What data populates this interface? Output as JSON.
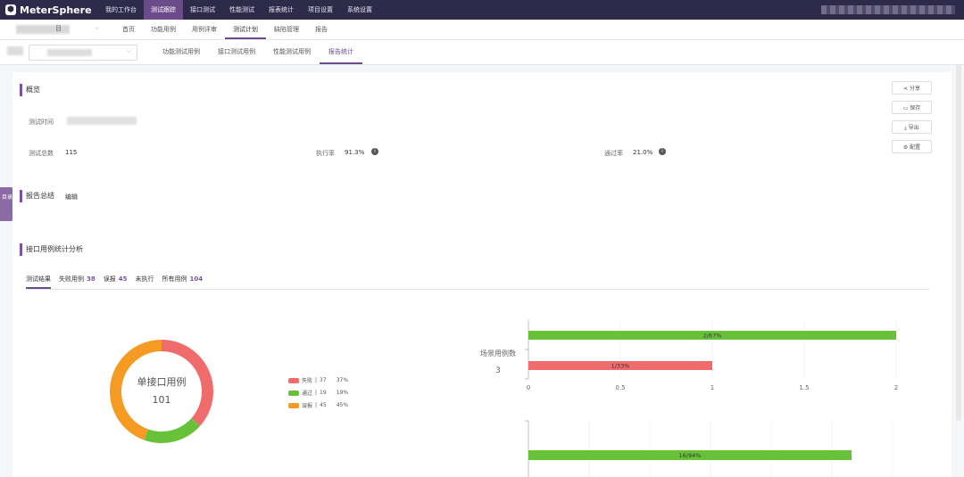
{
  "app": {
    "brand": "MeterSphere"
  },
  "topnav": [
    {
      "label": "我的工作台",
      "active": false
    },
    {
      "label": "测试跟踪",
      "active": true
    },
    {
      "label": "接口测试",
      "active": false
    },
    {
      "label": "性能测试",
      "active": false
    },
    {
      "label": "报表统计",
      "active": false
    },
    {
      "label": "项目设置",
      "active": false
    },
    {
      "label": "系统设置",
      "active": false
    }
  ],
  "project": {
    "label_suffix": "目"
  },
  "subnav": [
    {
      "label": "首页",
      "active": false
    },
    {
      "label": "功能用例",
      "active": false
    },
    {
      "label": "用例评审",
      "active": false
    },
    {
      "label": "测试计划",
      "active": true
    },
    {
      "label": "缺陷管理",
      "active": false
    },
    {
      "label": "报告",
      "active": false
    }
  ],
  "report_tabs": [
    {
      "label": "功能测试用例",
      "active": false
    },
    {
      "label": "接口测试用例",
      "active": false
    },
    {
      "label": "性能测试用例",
      "active": false
    },
    {
      "label": "报告统计",
      "active": true
    }
  ],
  "side_tab": {
    "label": "目录"
  },
  "actions": {
    "share": "分享",
    "save": "保存",
    "export": "导出",
    "config": "配置"
  },
  "overview": {
    "title": "概览",
    "test_time_label": "测试时间",
    "total_label": "测试总数",
    "total_value": "115",
    "exec_rate_label": "执行率",
    "exec_rate_value": "91.3%",
    "pass_rate_label": "通过率",
    "pass_rate_value": "21.0%"
  },
  "summary": {
    "title": "报告总结",
    "edit": "编辑"
  },
  "api_analysis": {
    "title": "接口用例统计分析",
    "tabs": [
      {
        "label": "测试结果",
        "count": "",
        "active": true
      },
      {
        "label": "失败用例",
        "count": "38",
        "active": false
      },
      {
        "label": "误报",
        "count": "45",
        "active": false
      },
      {
        "label": "未执行",
        "count": "",
        "active": false
      },
      {
        "label": "所有用例",
        "count": "104",
        "active": false
      }
    ]
  },
  "chart_data": [
    {
      "type": "pie",
      "title": "单接口用例",
      "total": "101",
      "slices": [
        {
          "name": "失败",
          "count": "37",
          "percent": "37%",
          "value": 37,
          "color": "#f06b6b"
        },
        {
          "name": "通过",
          "count": "19",
          "percent": "19%",
          "value": 19,
          "color": "#67c23a"
        },
        {
          "name": "误报",
          "count": "45",
          "percent": "45%",
          "value": 45,
          "color": "#f59a23"
        }
      ]
    },
    {
      "type": "bar",
      "orientation": "horizontal",
      "title": "场景用例数",
      "total": "3",
      "xlim": [
        0,
        2
      ],
      "xticks": [
        "0",
        "0.5",
        "1",
        "1.5",
        "2"
      ],
      "bars": [
        {
          "value": 2,
          "label": "2/67%",
          "color": "#67c23a"
        },
        {
          "value": 1,
          "label": "1/33%",
          "color": "#f06b6b"
        }
      ]
    },
    {
      "type": "bar",
      "orientation": "horizontal",
      "bars": [
        {
          "label": "16/94%",
          "color": "#67c23a"
        }
      ]
    }
  ]
}
